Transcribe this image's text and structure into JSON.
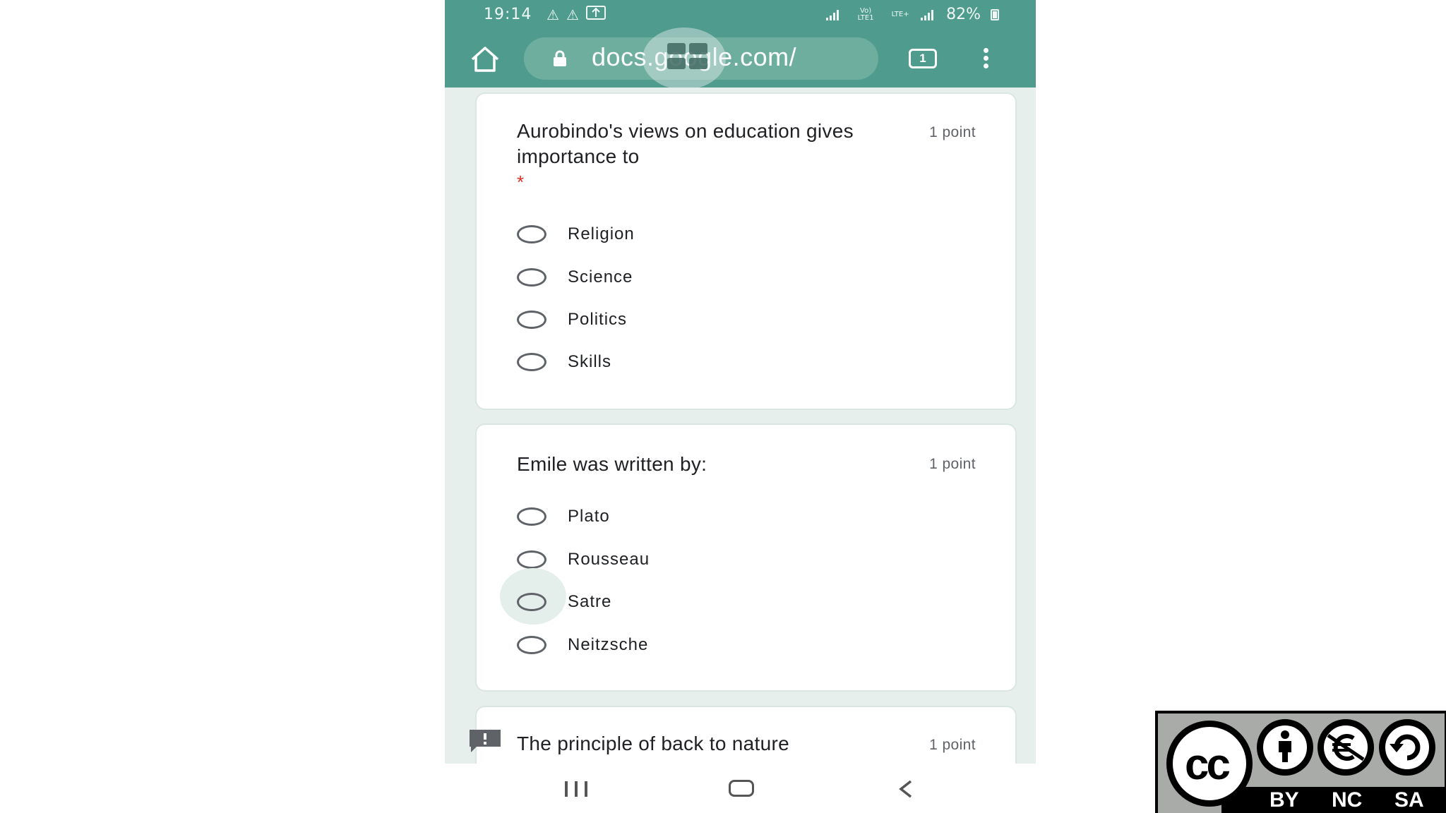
{
  "status_bar": {
    "time": "19:14",
    "network_label_1": "Vo) LTE1",
    "network_label_2": "LTE+",
    "battery": "82%"
  },
  "browser": {
    "url": "docs.google.com/",
    "tab_count": "1"
  },
  "questions": [
    {
      "title": "Aurobindo's views on education gives importance to",
      "points": "1 point",
      "required_mark": "*",
      "options": [
        "Religion",
        "Science",
        "Politics",
        "Skills"
      ]
    },
    {
      "title": "Emile was written by:",
      "points": "1 point",
      "options": [
        "Plato",
        "Rousseau",
        "Satre",
        "Neitzsche"
      ]
    },
    {
      "title": "The principle of back to nature",
      "points": "1 point"
    }
  ],
  "license_badge": {
    "labels": [
      "BY",
      "NC",
      "SA"
    ],
    "cc_text": "cc"
  },
  "colors": {
    "toolbar": "#4f9c8e",
    "page_background": "#e7efed",
    "required": "#d93025"
  }
}
